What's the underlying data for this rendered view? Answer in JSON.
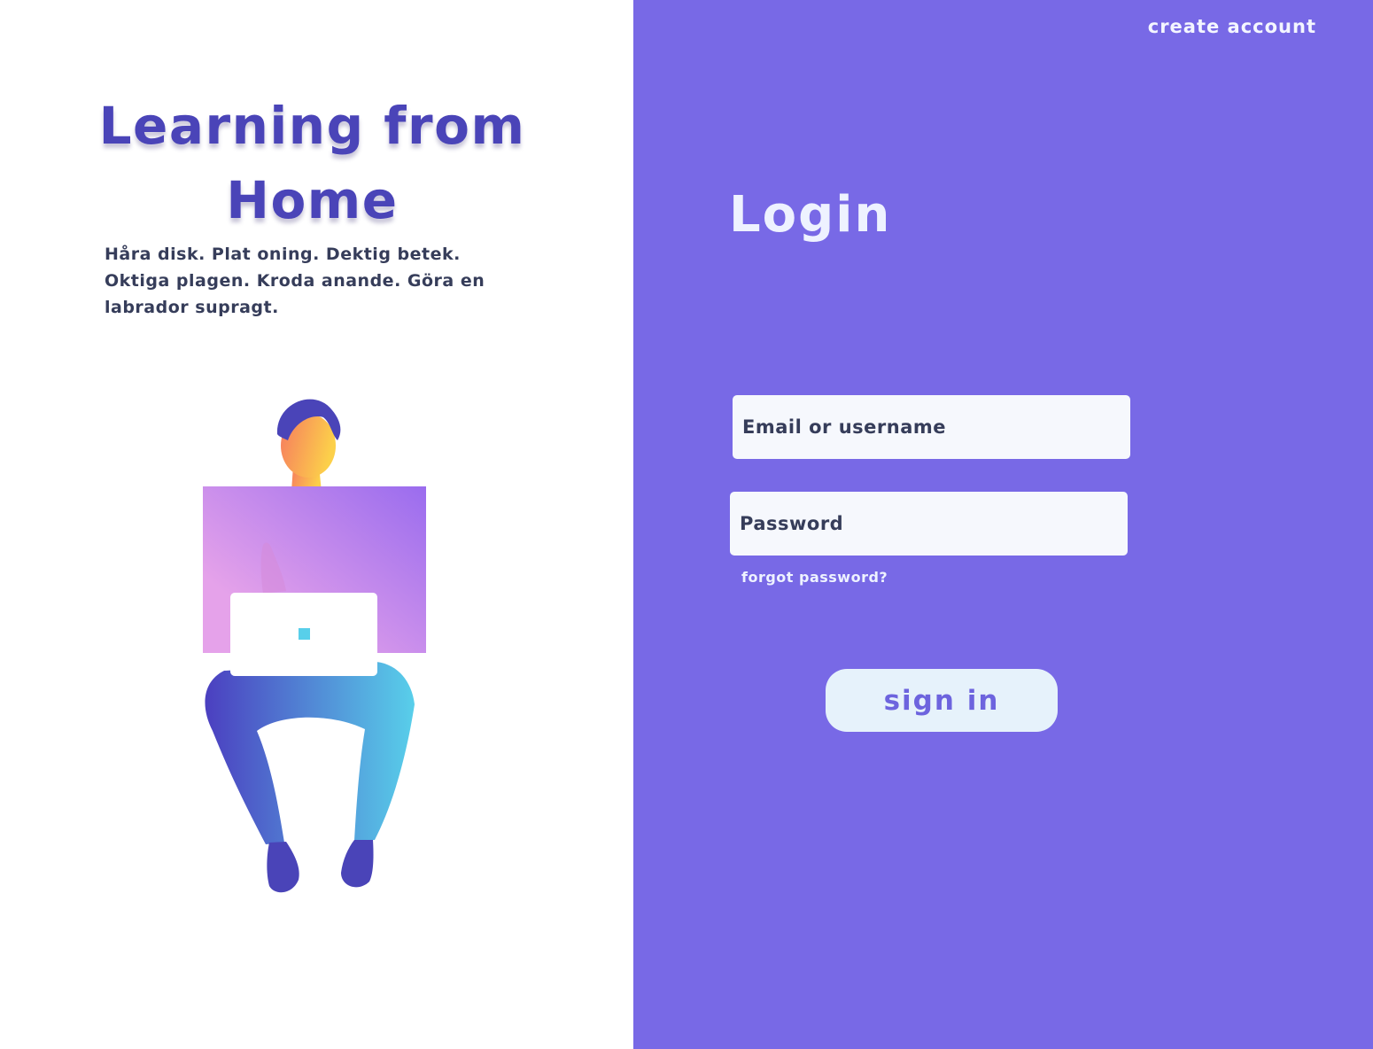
{
  "hero": {
    "title": "Learning from Home",
    "description": "Håra disk. Plat oning. Dektig betek. Oktiga plagen. Kroda anande. Göra en labrador supragt."
  },
  "header": {
    "create_account_label": "create account"
  },
  "login": {
    "title": "Login",
    "email_placeholder": "Email or username",
    "password_placeholder": "Password",
    "forgot_password_label": "forgot password?",
    "sign_in_label": "sign in"
  },
  "colors": {
    "panel_background": "#7869e6",
    "title_color": "#4a44b8",
    "button_background": "#e6f2fb",
    "button_text": "#6d64de",
    "field_background": "#f6f8fd"
  },
  "icons": {
    "illustration": "person-with-laptop-illustration"
  }
}
